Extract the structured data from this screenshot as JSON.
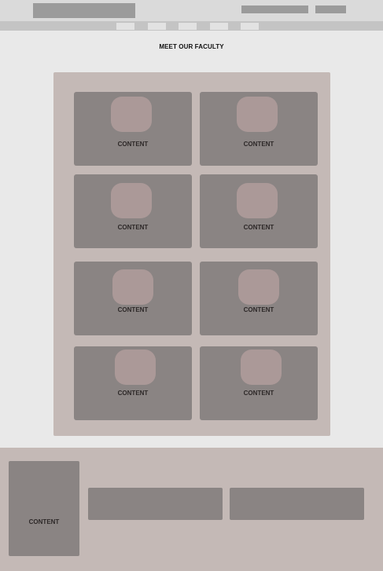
{
  "header": {
    "nav_items": [
      "",
      "",
      "",
      "",
      ""
    ]
  },
  "main": {
    "title": "MEET OUR FACULTY",
    "faculty_cards": [
      {
        "label": "CONTENT"
      },
      {
        "label": "CONTENT"
      },
      {
        "label": "CONTENT"
      },
      {
        "label": "CONTENT"
      },
      {
        "label": "CONTENT"
      },
      {
        "label": "CONTENT"
      },
      {
        "label": "CONTENT"
      },
      {
        "label": "CONTENT"
      }
    ]
  },
  "footer": {
    "card_label": "CONTENT"
  },
  "colors": {
    "page_bg": "#e9e9e9",
    "panel_bg": "#c4b9b6",
    "card_bg": "#8a8483",
    "avatar_bg": "#ab9998",
    "topbar_bg": "#dadada",
    "navbar_bg": "#c4c4c4"
  }
}
